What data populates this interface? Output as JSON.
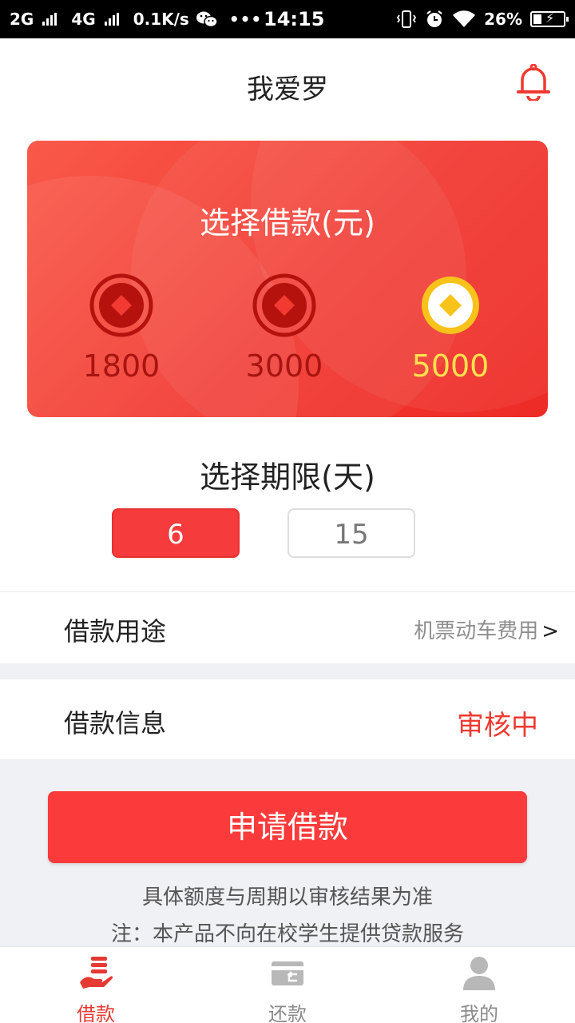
{
  "status_bar": {
    "network1": "2G",
    "network2": "4G",
    "speed": "0.1K/s",
    "dots": "•••",
    "time": "14:15",
    "battery": "26%"
  },
  "header": {
    "title": "我爱罗"
  },
  "loan_card": {
    "title": "选择借款(元)",
    "amounts": [
      "1800",
      "3000",
      "5000"
    ],
    "selected_amount": "5000"
  },
  "term": {
    "title": "选择期限(天)",
    "options": [
      "6",
      "15"
    ],
    "selected": "6"
  },
  "purpose_row": {
    "label": "借款用途",
    "value": "机票动车费用",
    "chevron": ">"
  },
  "info_row": {
    "label": "借款信息",
    "status": "审核中"
  },
  "apply_button": {
    "label": "申请借款"
  },
  "notes": {
    "line1": "具体额度与周期以审核结果为准",
    "line2": "注：本产品不向在校学生提供贷款服务"
  },
  "bottom_nav": {
    "items": [
      {
        "label": "借款",
        "icon": "loan-hand-icon",
        "active": true
      },
      {
        "label": "还款",
        "icon": "repay-card-icon",
        "active": false
      },
      {
        "label": "我的",
        "icon": "user-icon",
        "active": false
      }
    ]
  },
  "colors": {
    "accent": "#f53b3b",
    "card": "#f23a32",
    "selected_coin": "#ffe14d",
    "status": "#ee3a32"
  }
}
